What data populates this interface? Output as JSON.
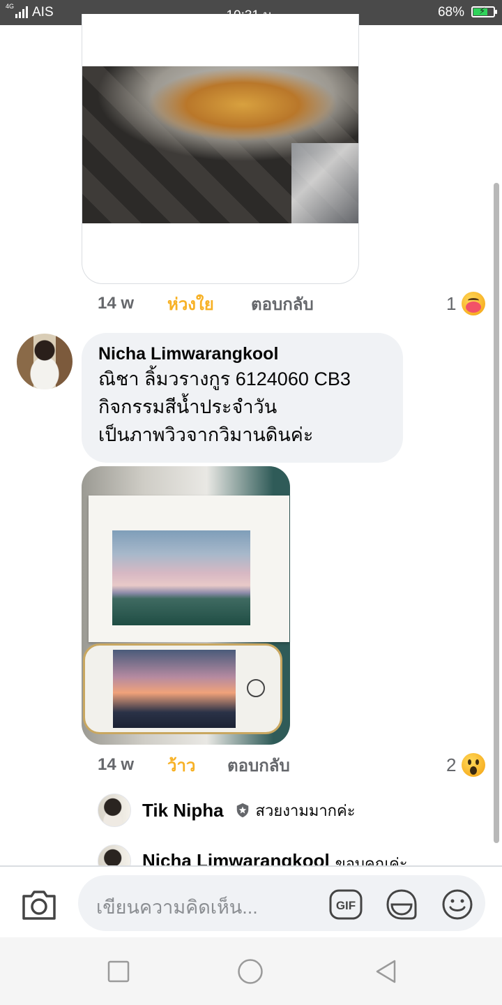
{
  "status_bar": {
    "network": "4G",
    "carrier": "AIS",
    "time": "10:31 น.",
    "battery": "68%",
    "battery_level": 0.68
  },
  "feed": {
    "first_comment": {
      "age": "14 w",
      "reaction_label": "ห่วงใย",
      "reply_label": "ตอบกลับ",
      "reaction_count": "1",
      "reaction_icon": "care-emoji-icon"
    },
    "comment": {
      "author": "Nicha Limwarangkool",
      "lines": [
        "ณิชา ลิ้มวรางกูร 6124060 CB3",
        "กิจกรรมสีน้ำประจำวัน",
        "เป็นภาพวิวจากวิมานดินค่ะ"
      ],
      "age": "14 w",
      "reaction_label": "ว้าว",
      "reply_label": "ตอบกลับ",
      "reaction_count": "2",
      "reaction_icon": "wow-emoji-icon"
    },
    "replies": [
      {
        "author": "Tik Nipha",
        "text": "สวยงามมากค่ะ",
        "badge_icon": "shield-badge-icon"
      },
      {
        "author": "Nicha Limwarangkool",
        "text": "ขอบคุณค่ะ"
      }
    ]
  },
  "composer": {
    "placeholder": "เขียนความคิดเห็น...",
    "gif_label": "GIF"
  },
  "colors": {
    "accent_reaction": "#f7b125",
    "muted_text": "#65676b",
    "bubble_bg": "#f0f2f5"
  }
}
